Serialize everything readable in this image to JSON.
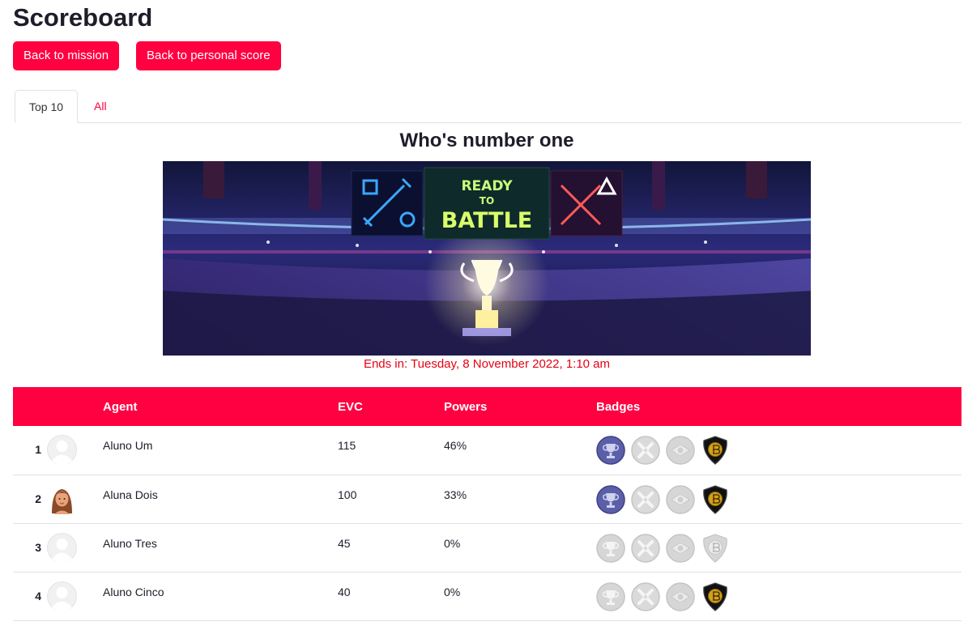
{
  "page": {
    "title": "Scoreboard"
  },
  "buttons": {
    "back_mission": "Back to mission",
    "back_score": "Back to personal score"
  },
  "tabs": [
    {
      "label": "Top 10",
      "active": true
    },
    {
      "label": "All",
      "active": false
    }
  ],
  "section": {
    "heading": "Who's number one",
    "ends": "Ends in: Tuesday, 8 November 2022, 1:10 am"
  },
  "banner": {
    "top_text": "READY",
    "mid_text": "TO",
    "bottom_text": "BATTLE"
  },
  "table": {
    "headers": {
      "agent": "Agent",
      "evc": "EVC",
      "powers": "Powers",
      "badges": "Badges"
    },
    "rows": [
      {
        "rank": "1",
        "name": "Aluno Um",
        "evc": "115",
        "powers": "46%",
        "avatar": "default-avatar",
        "badges": [
          "trophy-earned",
          "cross-locked",
          "eye-locked",
          "bitcoin-earned"
        ]
      },
      {
        "rank": "2",
        "name": "Aluna Dois",
        "evc": "100",
        "powers": "33%",
        "avatar": "girl-avatar",
        "badges": [
          "trophy-earned",
          "cross-locked",
          "eye-locked",
          "bitcoin-earned"
        ]
      },
      {
        "rank": "3",
        "name": "Aluno Tres",
        "evc": "45",
        "powers": "0%",
        "avatar": "default-avatar",
        "badges": [
          "trophy-locked",
          "cross-locked",
          "eye-locked",
          "bitcoin-locked"
        ]
      },
      {
        "rank": "4",
        "name": "Aluno Cinco",
        "evc": "40",
        "powers": "0%",
        "avatar": "default-avatar",
        "badges": [
          "trophy-locked",
          "cross-locked",
          "eye-locked",
          "bitcoin-earned"
        ]
      }
    ]
  },
  "colors": {
    "accent": "#ff0040",
    "deadline": "#e60012",
    "trophy_earned": "#5a5fa8",
    "badge_locked": "#d6d6d6",
    "bitcoin_gold": "#d4a017"
  }
}
